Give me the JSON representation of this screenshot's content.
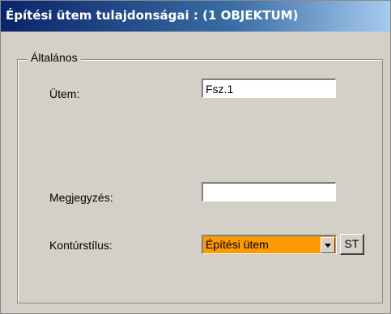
{
  "window": {
    "title": "Építési ütem tulajdonságai :  (1 OBJEKTUM)"
  },
  "group": {
    "legend": "Általános"
  },
  "fields": {
    "utem": {
      "label": "Ütem:",
      "value": "Fsz.1"
    },
    "megjegyzes": {
      "label": "Megjegyzés:",
      "value": ""
    },
    "konturstilus": {
      "label": "Kontúrstílus:",
      "value": "Építési ütem",
      "highlight_color": "#ff9900"
    }
  },
  "buttons": {
    "st_label": "ST"
  },
  "colors": {
    "titlebar_start": "#0a246a",
    "titlebar_end": "#a6caf0",
    "dialog_background": "#d4d0c8"
  }
}
